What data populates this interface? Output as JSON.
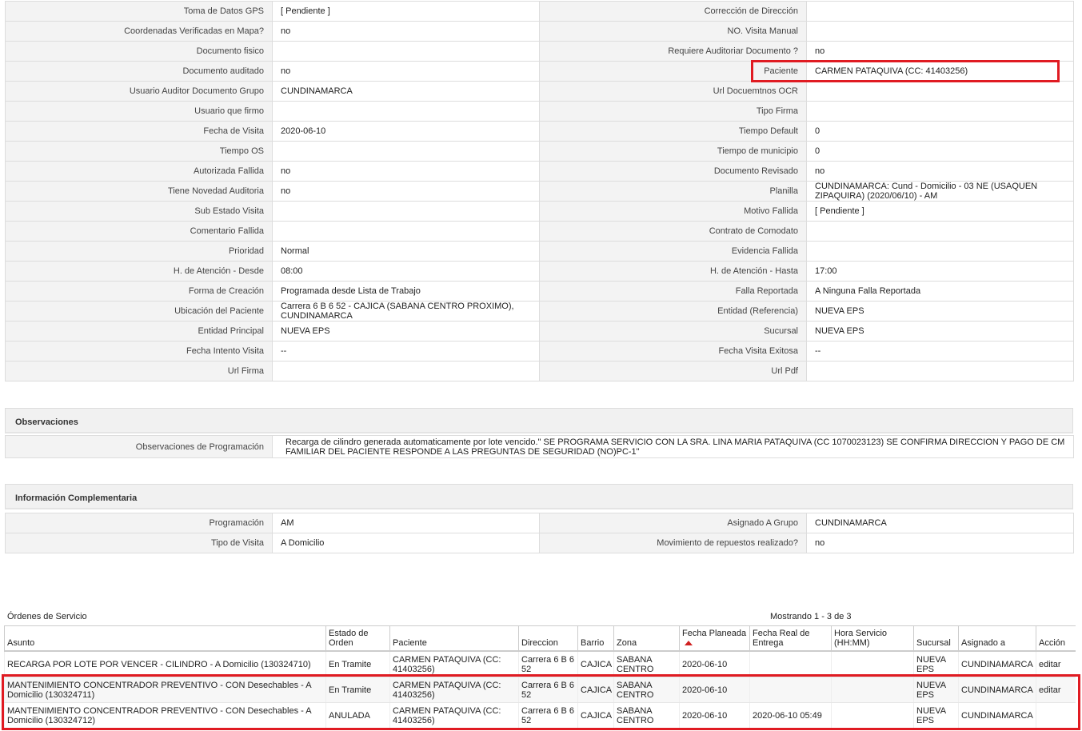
{
  "details": [
    [
      "Toma de Datos GPS",
      "[ Pendiente ]",
      "Corrección de Dirección",
      ""
    ],
    [
      "Coordenadas Verificadas en Mapa?",
      "no",
      "NO. Visita Manual",
      ""
    ],
    [
      "Documento fisico",
      "",
      "Requiere Auditoriar Documento ?",
      "no"
    ],
    [
      "Documento auditado",
      "no",
      "Paciente",
      "CARMEN PATAQUIVA (CC: 41403256)"
    ],
    [
      "Usuario Auditor Documento Grupo",
      "CUNDINAMARCA",
      "Url Docuemtnos OCR",
      ""
    ],
    [
      "Usuario que firmo",
      "",
      "Tipo Firma",
      ""
    ],
    [
      "Fecha de Visita",
      "2020-06-10",
      "Tiempo Default",
      "0"
    ],
    [
      "Tiempo OS",
      "",
      "Tiempo de municipio",
      "0"
    ],
    [
      "Autorizada Fallida",
      "no",
      "Documento Revisado",
      "no"
    ],
    [
      "Tiene Novedad Auditoria",
      "no",
      "Planilla",
      "CUNDINAMARCA: Cund - Domicilio - 03 NE (USAQUEN ZIPAQUIRA) (2020/06/10) - AM"
    ],
    [
      "Sub Estado Visita",
      "",
      "Motivo Fallida",
      "[ Pendiente ]"
    ],
    [
      "Comentario Fallida",
      "",
      "Contrato de Comodato",
      ""
    ],
    [
      "Prioridad",
      "Normal",
      "Evidencia Fallida",
      ""
    ],
    [
      "H. de Atención - Desde",
      "08:00",
      "H. de Atención - Hasta",
      "17:00"
    ],
    [
      "Forma de Creación",
      "Programada desde Lista de Trabajo",
      "Falla Reportada",
      "A Ninguna Falla Reportada"
    ],
    [
      "Ubicación del Paciente",
      "Carrera 6 B 6 52 - CAJICA (SABANA CENTRO PROXIMO), CUNDINAMARCA",
      "Entidad (Referencia)",
      "NUEVA EPS"
    ],
    [
      "Entidad Principal",
      "NUEVA EPS",
      "Sucursal",
      "NUEVA EPS"
    ],
    [
      "Fecha Intento Visita",
      "--",
      "Fecha Visita Exitosa",
      "--"
    ],
    [
      "Url Firma",
      "",
      "Url Pdf",
      ""
    ]
  ],
  "observaciones": {
    "title": "Observaciones",
    "label": "Observaciones de Programación",
    "text": "Recarga de cilindro generada automaticamente por lote vencido.\" SE PROGRAMA SERVICIO CON LA SRA. LINA MARIA PATAQUIVA (CC 1070023123) SE CONFIRMA DIRECCION Y PAGO DE CM FAMILIAR DEL PACIENTE RESPONDE A LAS PREGUNTAS DE SEGURIDAD (NO)PC-1\""
  },
  "complementaria": {
    "title": "Información Complementaria",
    "rows": [
      [
        "Programación",
        "AM",
        "Asignado A Grupo",
        "CUNDINAMARCA"
      ],
      [
        "Tipo de Visita",
        "A Domicilio",
        "Movimiento de repuestos realizado?",
        "no"
      ]
    ]
  },
  "ordenes": {
    "title": "Órdenes de Servicio",
    "count": "Mostrando 1 - 3 de 3",
    "columns": [
      "Asunto",
      "Estado de Orden",
      "Paciente",
      "Direccion",
      "Barrio",
      "Zona",
      "Fecha Planeada",
      "Fecha Real de Entrega",
      "Hora Servicio (HH:MM)",
      "Sucursal",
      "Asignado a",
      "Acción"
    ],
    "rows": [
      [
        "RECARGA POR LOTE POR VENCER - CILINDRO - A Domicilio (130324710)",
        "En Tramite",
        "CARMEN PATAQUIVA (CC: 41403256)",
        "Carrera 6 B 6 52",
        "CAJICA",
        "SABANA CENTRO",
        "2020-06-10",
        "",
        "",
        "NUEVA EPS",
        "CUNDINAMARCA",
        "editar"
      ],
      [
        "MANTENIMIENTO CONCENTRADOR PREVENTIVO - CON Desechables - A Domicilio (130324711)",
        "En Tramite",
        "CARMEN PATAQUIVA (CC: 41403256)",
        "Carrera 6 B 6 52",
        "CAJICA",
        "SABANA CENTRO",
        "2020-06-10",
        "",
        "",
        "NUEVA EPS",
        "CUNDINAMARCA",
        "editar"
      ],
      [
        "MANTENIMIENTO CONCENTRADOR PREVENTIVO - CON Desechables - A Domicilio (130324712)",
        "ANULADA",
        "CARMEN PATAQUIVA (CC: 41403256)",
        "Carrera 6 B 6 52",
        "CAJICA",
        "SABANA CENTRO",
        "2020-06-10",
        "2020-06-10 05:49",
        "",
        "NUEVA EPS",
        "CUNDINAMARCA",
        ""
      ]
    ]
  },
  "colors": {
    "highlight": "#e01b22",
    "label_bg": "#f3f3f3",
    "sort_arrow": "#d02020"
  }
}
